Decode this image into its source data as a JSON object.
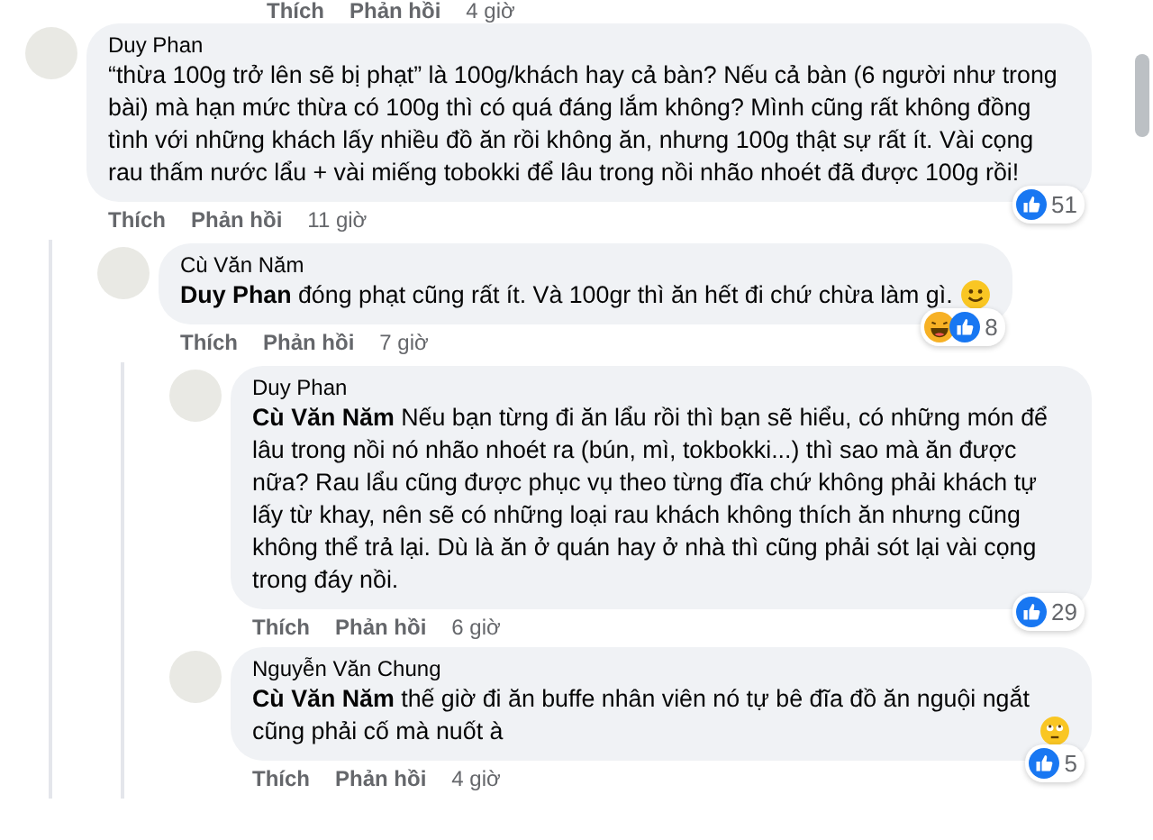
{
  "previous_actions": {
    "like": "Thích",
    "reply": "Phản hồi",
    "time": "4 giờ"
  },
  "comments": [
    {
      "author": "Duy Phan",
      "text": "“thừa 100g trở lên sẽ bị phạt” là 100g/khách hay cả bàn? Nếu cả bàn (6 người như trong bài) mà hạn mức thừa có 100g thì có quá đáng lắm không? Mình cũng rất không đồng tình với những khách lấy nhiều đồ ăn rồi không ăn, nhưng 100g thật sự rất ít. Vài cọng rau thấm nước lẩu + vài miếng tobokki để lâu trong nồi nhão nhoét đã được 100g rồi!",
      "actions": {
        "like": "Thích",
        "reply": "Phản hồi",
        "time": "11 giờ"
      },
      "reactions": {
        "kind": "like",
        "count": "51"
      },
      "children": [
        {
          "author": "Cù Văn Năm",
          "text": "**Duy Phan** đóng phạt cũng rất ít. Và 100gr thì ăn hết đi chứ chừa làm gì.",
          "emoji": {
            "kind": "smile"
          },
          "actions": {
            "like": "Thích",
            "reply": "Phản hồi",
            "time": "7 giờ"
          },
          "reactions": {
            "kind": "haha-like",
            "count": "8"
          },
          "children": [
            {
              "author": "Duy Phan",
              "text": "**Cù Văn Năm** Nếu bạn từng đi ăn lẩu rồi thì bạn sẽ hiểu, có những món để lâu trong nồi nó nhão nhoét ra (bún, mì, tokbokki...) thì sao mà ăn được nữa? Rau lẩu cũng được phục vụ theo từng đĩa chứ không phải khách tự lấy từ khay, nên sẽ có những loại rau khách không thích ăn nhưng cũng không thể trả lại. Dù là ăn ở quán hay ở nhà thì cũng phải sót lại vài cọng trong đáy nồi.",
              "actions": {
                "like": "Thích",
                "reply": "Phản hồi",
                "time": "6 giờ"
              },
              "reactions": {
                "kind": "like",
                "count": "29"
              }
            },
            {
              "author": "Nguyễn Văn Chung",
              "text": "**Cù Văn Năm** thế giờ đi ăn buffe nhân viên nó tự bê đĩa đồ ăn nguội ngắt cũng phải cố mà nuốt à",
              "emoji": {
                "kind": "eye-roll"
              },
              "actions": {
                "like": "Thích",
                "reply": "Phản hồi",
                "time": "4 giờ"
              },
              "reactions": {
                "kind": "like",
                "count": "5"
              }
            }
          ]
        }
      ]
    }
  ]
}
